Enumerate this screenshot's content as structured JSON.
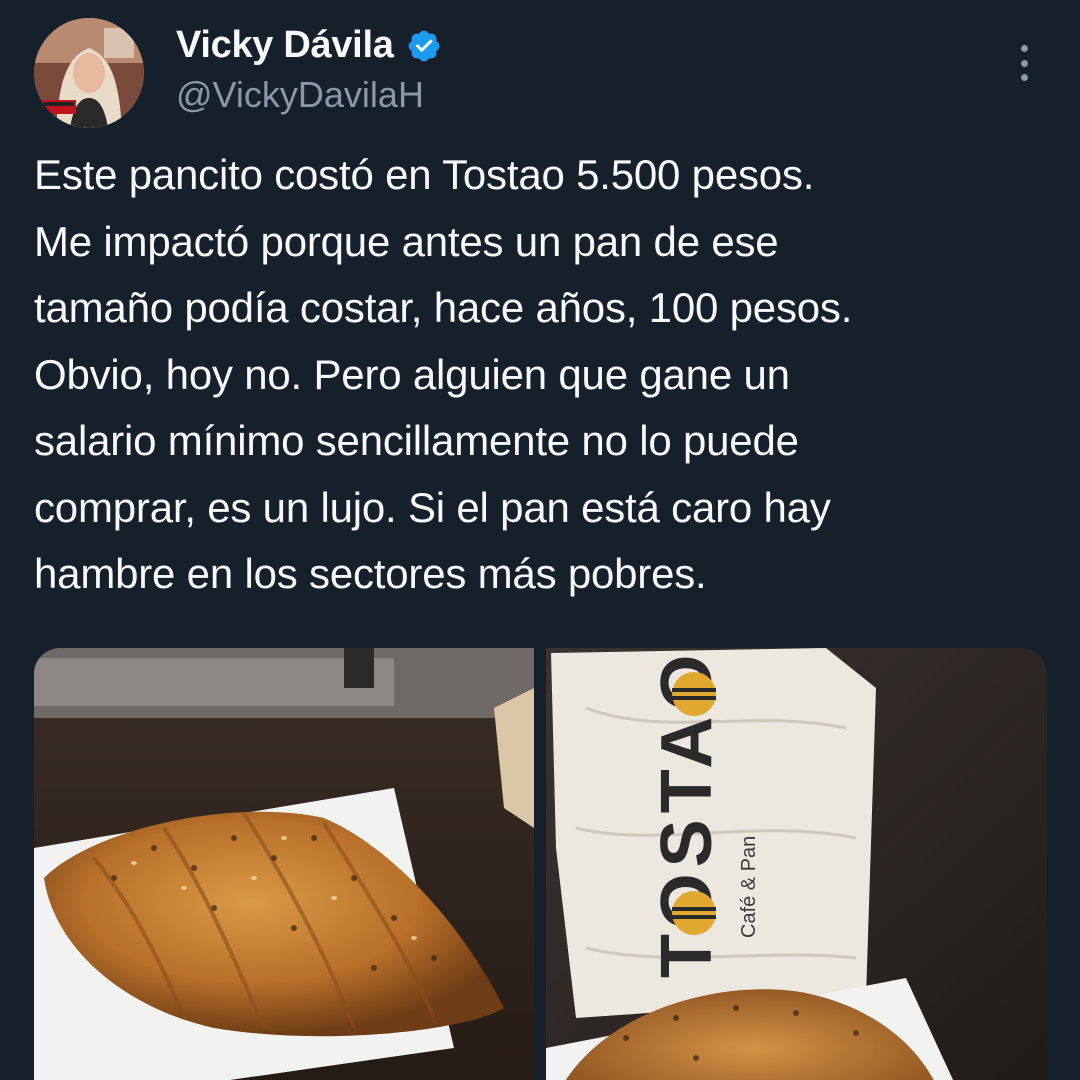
{
  "tweet": {
    "author": {
      "display_name": "Vicky Dávila",
      "handle": "@VickyDavilaH",
      "verified": true
    },
    "text": "Este pancito costó en Tostao 5.500 pesos.\nMe impactó porque antes un pan de ese\ntamaño podía costar, hace años, 100 pesos.\nObvio, hoy no. Pero alguien que gane un\nsalario mínimo sencillamente no lo puede\ncomprar, es un lujo. Si el pan está caro hay\nhambre en los sectores más pobres.",
    "media": {
      "bag_brand": "TOSTAO",
      "bag_tagline": "Café & Pan"
    }
  },
  "colors": {
    "background": "#15202b",
    "text_primary": "#f7f9f9",
    "text_secondary": "#8b98a5",
    "verified_blue": "#1d9bf0"
  },
  "icons": {
    "verified": "verified-badge-icon",
    "more": "more-options-icon"
  }
}
